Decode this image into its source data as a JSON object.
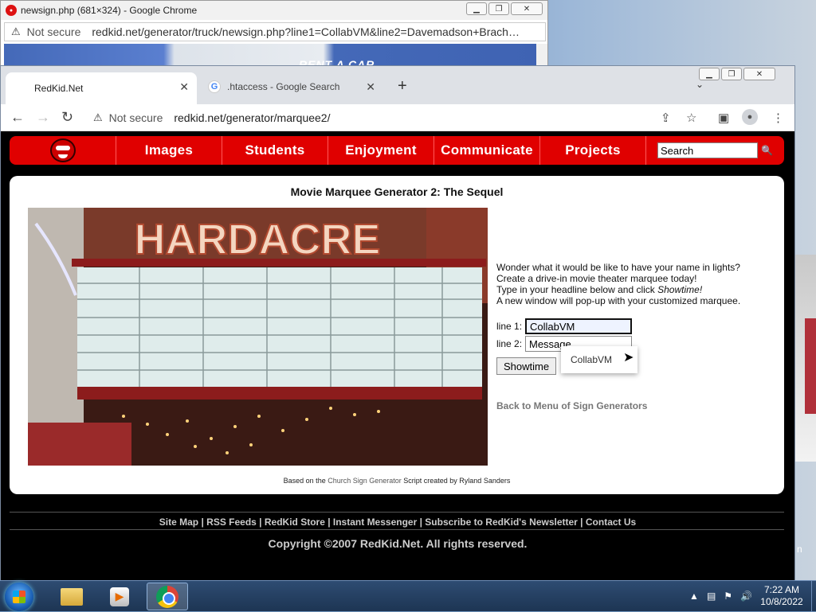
{
  "back_window": {
    "title": "newsign.php (681×324) - Google Chrome",
    "not_secure": "Not secure",
    "url": "redkid.net/generator/truck/newsign.php?line1=CollabVM&line2=Davemadson+Brach…",
    "truck_text": "RENT A CAR"
  },
  "browser": {
    "tabs": [
      {
        "label": "RedKid.Net",
        "active": true
      },
      {
        "label": ".htaccess - Google Search",
        "active": false
      }
    ],
    "not_secure": "Not secure",
    "url": "redkid.net/generator/marquee2/"
  },
  "site": {
    "nav": [
      "Images",
      "Students",
      "Enjoyment",
      "Communicate",
      "Projects"
    ],
    "search_value": "Search"
  },
  "content": {
    "title": "Movie Marquee Generator 2: The Sequel",
    "sign_text": "HARDACRE",
    "intro_lines": [
      "Wonder what it would be like to have your name in lights?",
      "Create a drive-in movie theater marquee today!",
      "Type in your headline below and click ",
      "Showtime!",
      "A new window will pop-up with your customized marquee."
    ],
    "line1_label": "line 1:",
    "line1_value": "CollabVM",
    "line2_label": "line 2:",
    "line2_value": "Message",
    "showtime_label": "Showtime",
    "autocomplete_item": "CollabVM",
    "back_link": "Back to Menu of Sign Generators",
    "credit_pre": "Based on the ",
    "credit_link": "Church Sign Generator",
    "credit_post": " Script created by Ryland Sanders"
  },
  "footer": {
    "links": "Site Map | RSS Feeds | RedKid Store | Instant Messenger | Subscribe to RedKid's Newsletter | Contact Us",
    "copyright": "Copyright ©2007 RedKid.Net. All rights reserved."
  },
  "taskbar": {
    "time": "7:22 AM",
    "date": "10/8/2022"
  },
  "desktop_fragment": "n",
  "colors": {
    "nav_red": "#e00000",
    "page_bg": "#000000",
    "panel_bg": "#ffffff"
  }
}
